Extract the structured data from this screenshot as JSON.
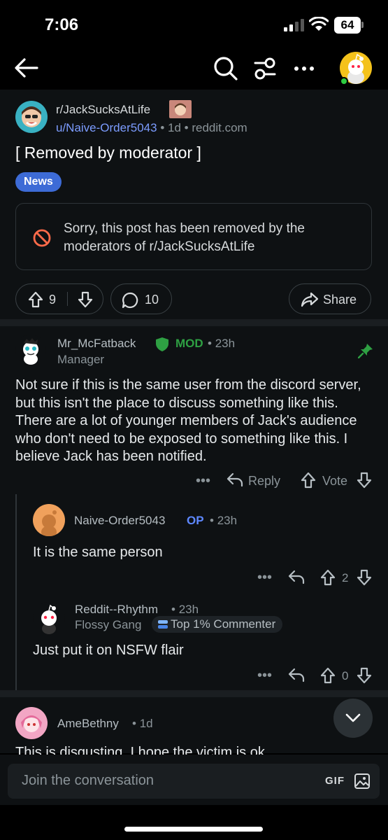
{
  "status_bar": {
    "time": "7:06",
    "battery": "64"
  },
  "header": {
    "back_icon": "arrow-left-icon",
    "search_icon": "search-icon",
    "filter_icon": "sliders-icon",
    "more_icon": "more-horizontal-icon",
    "avatar_icon": "user-avatar-icon"
  },
  "post": {
    "subreddit": "r/JackSucksAtLife",
    "author": "u/Naive-Order5043",
    "age": "1d",
    "domain": "reddit.com",
    "title": "[ Removed by moderator ]",
    "flair": "News",
    "flair_color": "#3d6bd6",
    "removed_message": "Sorry, this post has been removed by the moderators of r/JackSucksAtLife",
    "upvotes": "9",
    "comments": "10",
    "share_label": "Share"
  },
  "comments": [
    {
      "author": "Mr_McFatback",
      "mod_label": "MOD",
      "age": "23h",
      "user_flair": "Manager",
      "body": "Not sure if this is the same user from the discord server, but this isn't the place to discuss something like this. There are a lot of younger members of Jack's audience who don't need to be exposed to something like this. I believe Jack has been notified.",
      "more": "•••",
      "reply_label": "Reply",
      "vote_label": "Vote"
    },
    {
      "author": "Naive-Order5043",
      "op_label": "OP",
      "age": "23h",
      "body": "It is the same person",
      "more": "•••",
      "score": "2"
    },
    {
      "author": "Reddit--Rhythm",
      "age": "23h",
      "user_flair": "Flossy Gang",
      "badge": "Top 1% Commenter",
      "body": "Just put it on NSFW flair",
      "more": "•••",
      "score": "0"
    },
    {
      "author": "AmeBethny",
      "age": "1d",
      "body_preview": "This is disgusting. I hope the victim is ok"
    }
  ],
  "composer": {
    "placeholder": "Join the conversation",
    "gif_label": "GIF",
    "image_icon": "image-icon"
  },
  "colors": {
    "background": "#0e1113",
    "mod_green": "#2ea043",
    "op_blue": "#5e88ff",
    "username_link": "#7c9cff"
  }
}
